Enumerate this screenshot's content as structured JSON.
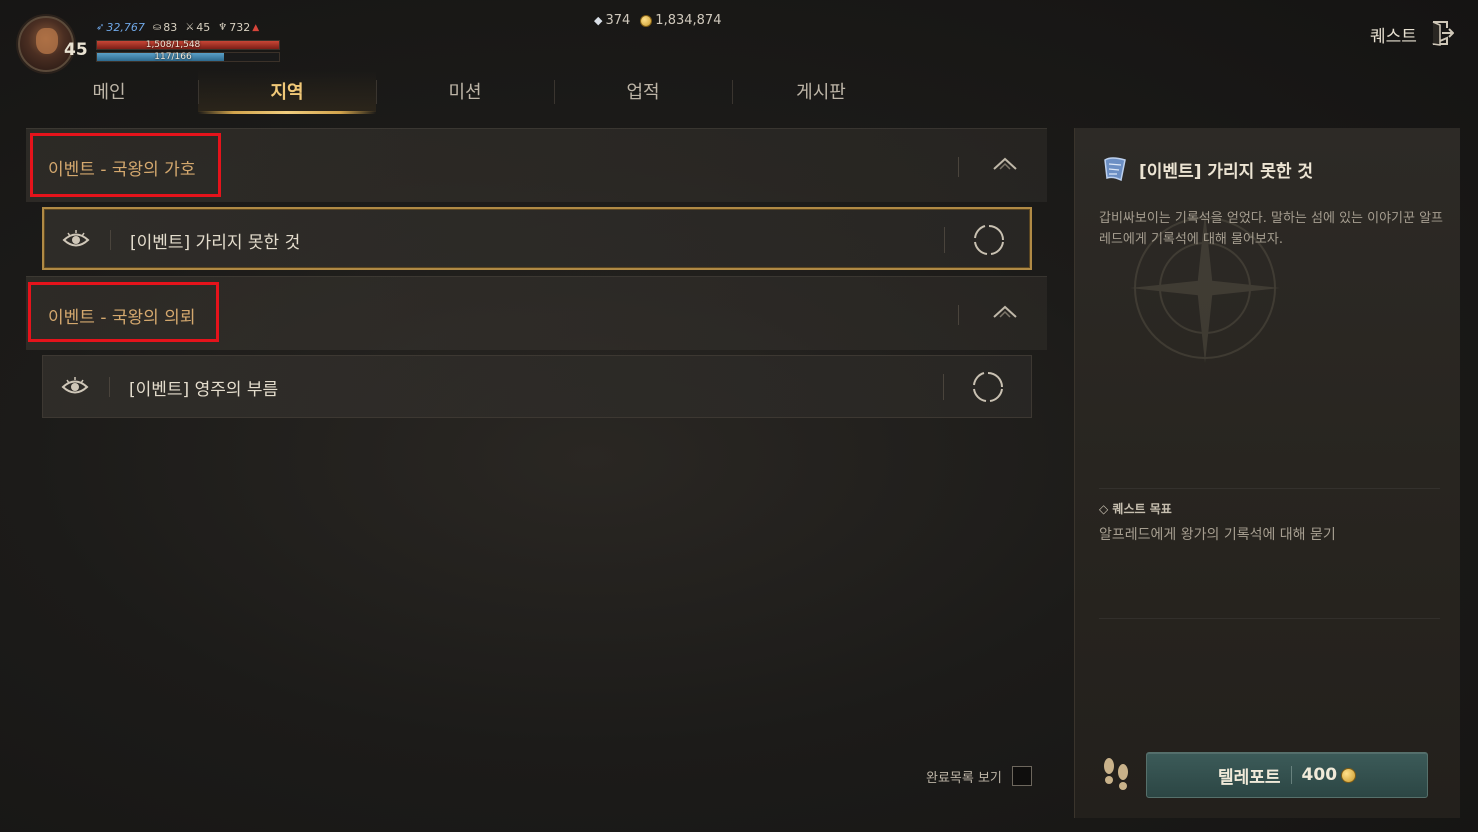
{
  "hud": {
    "level": "45",
    "power": "32,767",
    "stat2": "83",
    "stat3": "45",
    "stat4": "732",
    "hp_text": "1,508/1,548",
    "mp_text": "117/166"
  },
  "currency": {
    "gems": "374",
    "gold": "1,834,874"
  },
  "header": {
    "quest_title": "퀘스트"
  },
  "tabs": [
    {
      "label": "메인"
    },
    {
      "label": "지역"
    },
    {
      "label": "미션"
    },
    {
      "label": "업적"
    },
    {
      "label": "게시판"
    }
  ],
  "groups": [
    {
      "title": "이벤트 - 국왕의 가호",
      "quest": "[이벤트] 가리지 못한 것"
    },
    {
      "title": "이벤트 - 국왕의 의뢰",
      "quest": "[이벤트] 영주의 부름"
    }
  ],
  "completed_toggle": "완료목록 보기",
  "detail": {
    "title": "[이벤트] 가리지 못한 것",
    "description": "갑비싸보이는 기록석을 얻었다. 말하는 섬에 있는 이야기꾼 알프레드에게 기록석에 대해 물어보자.",
    "objective_label": "◇ 퀘스트 목표",
    "objective_text": "알프레드에게 왕가의 기록석에 대해 묻기"
  },
  "teleport": {
    "label": "텔레포트",
    "cost": "400"
  },
  "colors": {
    "accent_gold": "#d4a86e",
    "active_tab": "#f0c878",
    "highlight_box": "#e5131b",
    "teleport_btn": "#3c5b59"
  }
}
